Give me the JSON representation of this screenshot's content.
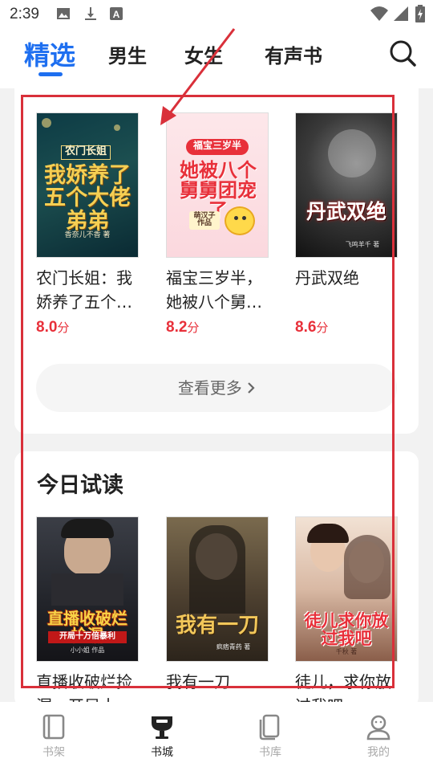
{
  "status_bar": {
    "time": "2:39",
    "left_icons": [
      "image-icon",
      "download-icon",
      "font-icon"
    ],
    "right_icons": [
      "wifi-icon",
      "signal-icon",
      "battery-charging-icon"
    ]
  },
  "header": {
    "tabs": [
      {
        "label": "精选",
        "active": true
      },
      {
        "label": "男生",
        "active": false
      },
      {
        "label": "女生",
        "active": false
      },
      {
        "label": "有声书",
        "active": false
      }
    ],
    "accent_color": "#1e6ff0",
    "search_icon": "search-icon"
  },
  "recommend": {
    "books": [
      {
        "title": "农门长姐：我娇养了五个…",
        "score": "8.0",
        "unit": "分",
        "cover_text": "我娇养了五个大佬弟弟",
        "cover_sub": "农门长姐",
        "cover_author": "香奈儿不香 著"
      },
      {
        "title": "福宝三岁半，她被八个舅…",
        "score": "8.2",
        "unit": "分",
        "cover_text": "她被八个舅舅团宠了",
        "cover_sub": "福宝三岁半",
        "cover_author": "萌汉子 作品"
      },
      {
        "title": "丹武双绝",
        "score": "8.6",
        "unit": "分",
        "cover_text": "丹武双绝",
        "cover_author": "飞鸣羊千 著"
      }
    ],
    "more_label": "查看更多",
    "score_color": "#e8303a"
  },
  "today_trial": {
    "title": "今日试读",
    "books": [
      {
        "title": "直播收破烂捡漏，开局十…",
        "cover_text": "直播收破烂捡漏",
        "cover_sub": "开局十万倍暴利",
        "cover_author": "小小姐 作品"
      },
      {
        "title": "我有一刀",
        "cover_text": "我有一刀",
        "cover_author": "疯痞青药 著"
      },
      {
        "title": "徒儿，求你放过我吧",
        "cover_text": "徒儿求你放过我吧",
        "cover_author": "千秋 著"
      }
    ]
  },
  "bottom_nav": {
    "items": [
      {
        "label": "书架",
        "icon": "bookshelf-icon",
        "active": false
      },
      {
        "label": "书城",
        "icon": "bookstore-icon",
        "active": true
      },
      {
        "label": "书库",
        "icon": "library-icon",
        "active": false
      },
      {
        "label": "我的",
        "icon": "profile-icon",
        "active": false
      }
    ]
  },
  "annotation": {
    "color": "#d9303a"
  }
}
